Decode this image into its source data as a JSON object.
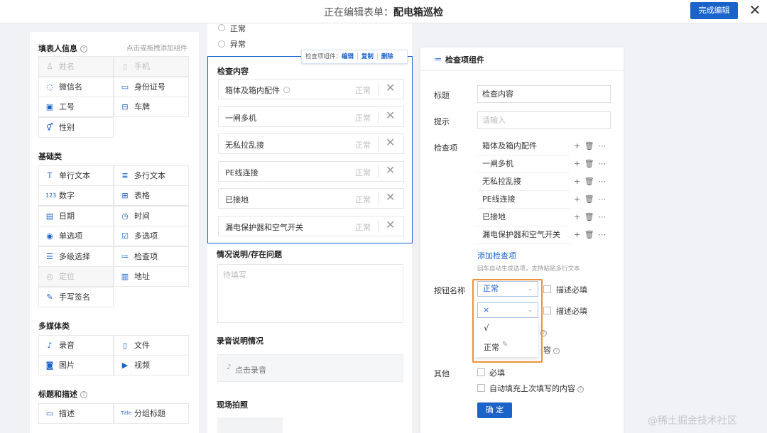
{
  "topbar": {
    "title_prefix": "正在编辑表单：",
    "title_name": "配电箱巡检",
    "finish_label": "完成编辑",
    "close_glyph": "✕"
  },
  "left": {
    "filler_title": "填表人信息",
    "hint": "点击或拖拽添加组件",
    "filler_items": [
      {
        "label": "姓名",
        "icon": "person-icon"
      },
      {
        "label": "手机",
        "icon": "phone-icon"
      },
      {
        "label": "微信名",
        "icon": "wechat-icon"
      },
      {
        "label": "身份证号",
        "icon": "id-card-icon"
      },
      {
        "label": "工号",
        "icon": "badge-icon"
      },
      {
        "label": "车牌",
        "icon": "car-icon"
      },
      {
        "label": "性别",
        "icon": "gender-icon"
      }
    ],
    "basic_title": "基础类",
    "basic_items": [
      {
        "label": "单行文本",
        "icon": "text-icon"
      },
      {
        "label": "多行文本",
        "icon": "multiline-icon"
      },
      {
        "label": "数字",
        "icon": "number-icon"
      },
      {
        "label": "表格",
        "icon": "table-icon"
      },
      {
        "label": "日期",
        "icon": "calendar-icon"
      },
      {
        "label": "时间",
        "icon": "clock-icon"
      },
      {
        "label": "单选项",
        "icon": "radio-icon"
      },
      {
        "label": "多选项",
        "icon": "checkbox-icon"
      },
      {
        "label": "多级选择",
        "icon": "cascade-icon"
      },
      {
        "label": "检查项",
        "icon": "checklist-icon"
      },
      {
        "label": "定位",
        "icon": "location-icon"
      },
      {
        "label": "地址",
        "icon": "address-icon"
      },
      {
        "label": "手写签名",
        "icon": "signature-icon"
      }
    ],
    "media_title": "多媒体类",
    "media_items": [
      {
        "label": "录音",
        "icon": "mic-icon"
      },
      {
        "label": "文件",
        "icon": "file-icon"
      },
      {
        "label": "图片",
        "icon": "image-icon"
      },
      {
        "label": "视频",
        "icon": "video-icon"
      }
    ],
    "heading_title": "标题和描述",
    "heading_items": [
      {
        "label": "描述",
        "icon": "description-icon"
      },
      {
        "label": "分组标题",
        "icon": "group-title-icon"
      }
    ]
  },
  "center": {
    "radio_options": [
      "正常",
      "异常"
    ],
    "toolbar": {
      "prefix": "检查项组件：",
      "edit": "编辑",
      "copy": "复制",
      "delete": "删除"
    },
    "check_title": "检查内容",
    "check_items": [
      "箱体及箱内配件",
      "一闸多机",
      "无私拉乱接",
      "PE线连接",
      "已接地",
      "漏电保护器和空气开关"
    ],
    "status_text": "正常",
    "situation_title": "情况说明/存在问题",
    "situation_placeholder": "待填写",
    "audio_title": "录音说明情况",
    "audio_label": "点击录音",
    "photo_title": "现场拍照"
  },
  "right": {
    "header": "检查项组件",
    "title_label": "标题",
    "title_value": "检查内容",
    "hint_label": "提示",
    "hint_placeholder": "请输入",
    "items_label": "检查项",
    "items": [
      "箱体及箱内配件",
      "一闸多机",
      "无私拉乱接",
      "PE线连接",
      "已接地",
      "漏电保护器和空气开关"
    ],
    "ops_glyphs": "+ 🗑 ⋯",
    "add_link": "添加检查项",
    "note": "回车自动生成选项，支持粘贴多行文本",
    "btn_name_label": "按钮名称",
    "btn1_value": "正常",
    "btn2_value": "×",
    "desc_required": "描述必填",
    "dropdown_options": [
      "√",
      "正常"
    ],
    "hidden_fragment": "容",
    "other_label": "其他",
    "required_label": "必填",
    "autofill_label": "自动填充上次填写的内容",
    "ok_label": "确 定"
  },
  "watermark": "@稀土掘金技术社区",
  "colors": {
    "accent": "#1a63c9",
    "highlight": "#f0923a"
  }
}
